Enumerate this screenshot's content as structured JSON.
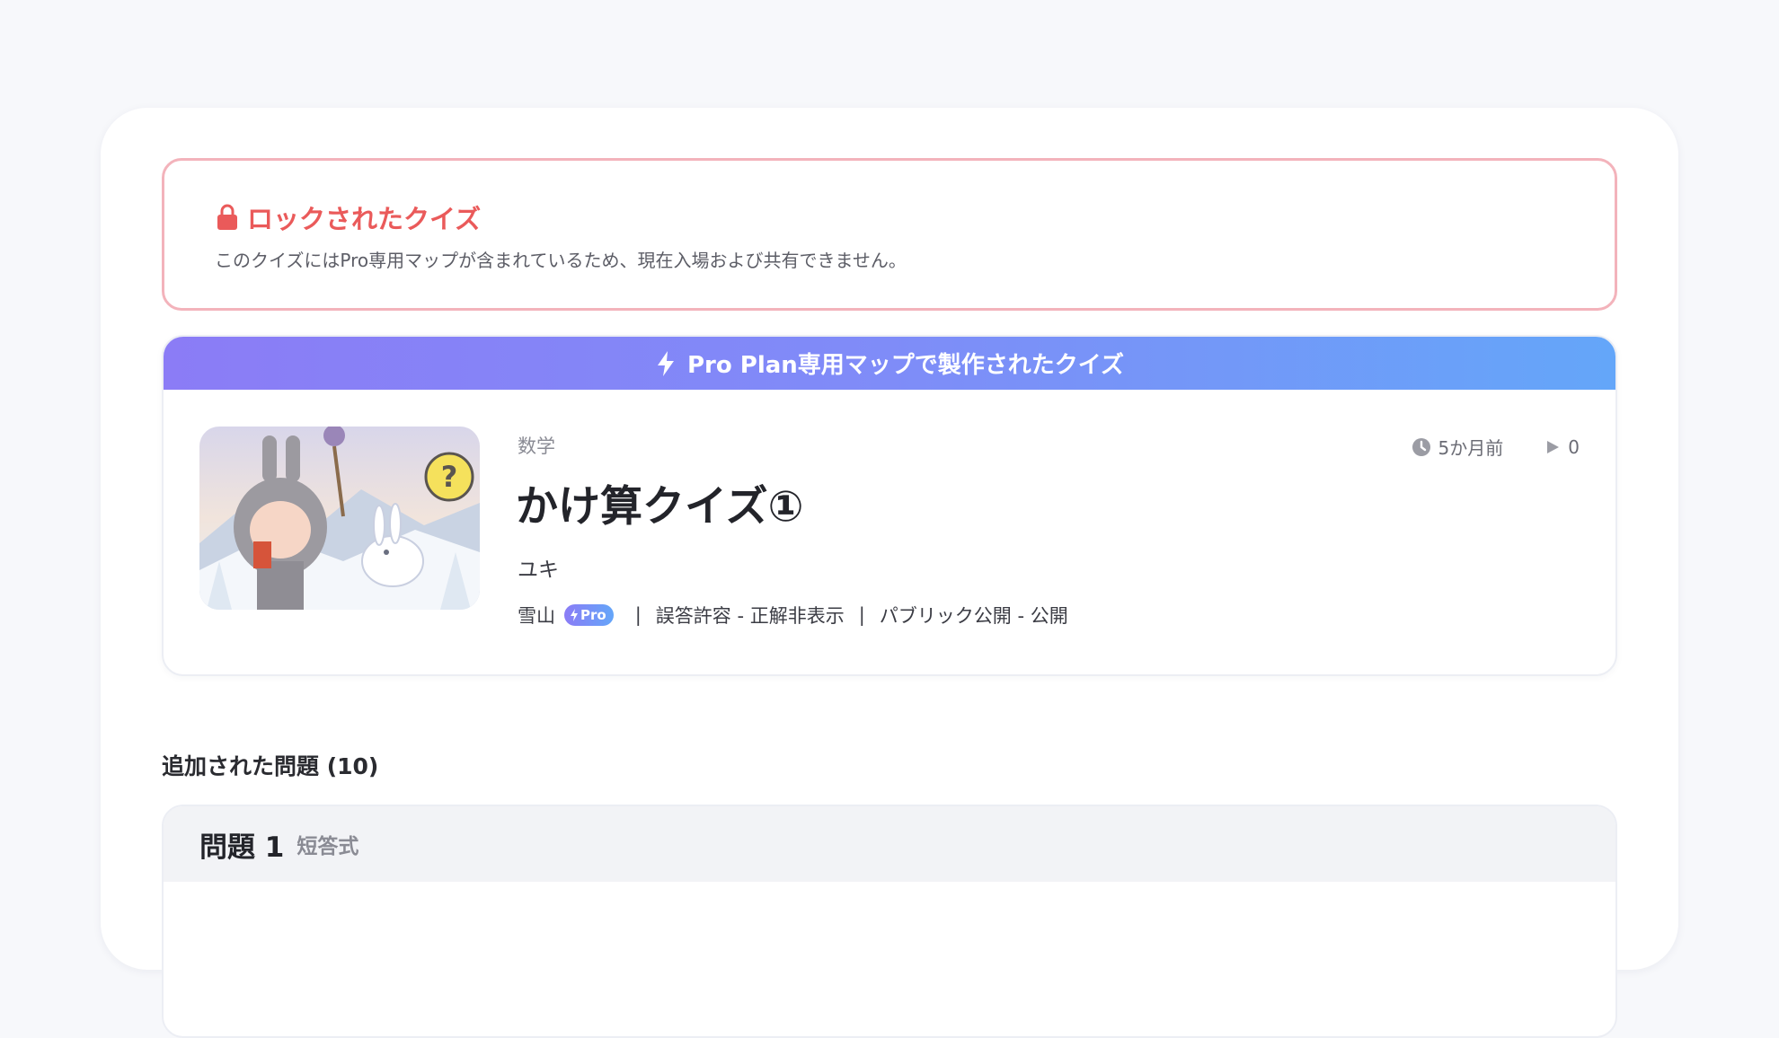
{
  "locked": {
    "title": "ロックされたクイズ",
    "description": "このクイズにはPro専用マップが含まれているため、現在入場および共有できません。",
    "icon": "lock-icon",
    "color": "#ea5a5a"
  },
  "banner": {
    "text": "Pro Plan専用マップで製作されたクイズ",
    "icon": "lightning-icon"
  },
  "quiz": {
    "category": "数学",
    "title": "かけ算クイズ①",
    "author": "ユキ",
    "map": "雪山",
    "pro_badge": "Pro",
    "setting_answer": "誤答許容 - 正解非表示",
    "setting_visibility": "パブリック公開 - 公開",
    "separator": "|",
    "updated": "5か月前",
    "plays": "0"
  },
  "questions": {
    "heading": "追加された問題 (10)",
    "items": [
      {
        "number": "問題 1",
        "type": "短答式"
      }
    ]
  }
}
